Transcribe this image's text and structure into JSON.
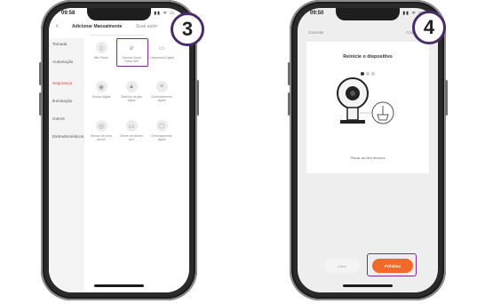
{
  "steps": {
    "left": "3",
    "right": "4"
  },
  "phone_left": {
    "status_time": "09:58",
    "status_icons": "▮▮ ᯤ ▭",
    "back": "‹",
    "title": "Adicionar Manualmente",
    "scan": "Scan autor",
    "categories": [
      "Tomada",
      "Automação",
      "Segurança",
      "Iluminação",
      "Outros",
      "Eletrodomésticos"
    ],
    "devices": [
      {
        "icon": "▯",
        "label": "Mini Piston"
      },
      {
        "icon": "⌀",
        "label": "Câmera Smart Home Wifi"
      },
      {
        "icon": "▭",
        "label": "Campainha Digital"
      },
      {
        "icon": "◉",
        "label": "Sensor digital"
      },
      {
        "icon": "▲",
        "label": "Detector de gás digital"
      },
      {
        "icon": "≡",
        "label": "Gerenciamento digital"
      },
      {
        "icon": "◎",
        "label": "Sensor de porta janela"
      },
      {
        "icon": "▭",
        "label": "Sirene de alarme wi-fi"
      },
      {
        "icon": "⬡",
        "label": "Gerenciamento digital"
      }
    ]
  },
  "phone_right": {
    "status_time": "09:50",
    "status_icons": "▮▮ ᯤ ▭",
    "cancel": "Cancelar",
    "next_top": "Código",
    "title": "Reinicie o dispositivo",
    "hint": "Piscar ao lâm devices",
    "btn_back": "Voltar",
    "btn_next": "Próximo"
  },
  "colors": {
    "accent_purple": "#7a2b8f",
    "badge_border": "#4a2b6b",
    "orange": "#f06a2a",
    "active_category": "#d14a3a"
  }
}
